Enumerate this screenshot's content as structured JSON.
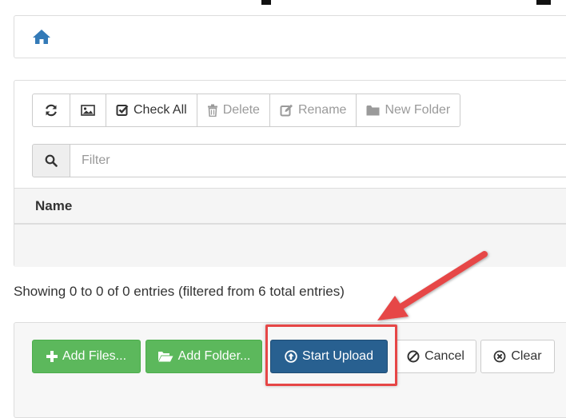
{
  "toolbar": {
    "refresh_icon": "refresh-icon",
    "image_icon": "image-icon",
    "check_all_label": "Check All",
    "delete_label": "Delete",
    "rename_label": "Rename",
    "new_folder_label": "New Folder"
  },
  "filter": {
    "placeholder": "Filter",
    "value": ""
  },
  "table": {
    "columns": [
      "Name"
    ],
    "rows": []
  },
  "status": {
    "showing_text": "Showing 0 to 0 of 0 entries (filtered from 6 total entries)"
  },
  "upload_bar": {
    "add_files_label": "Add Files...",
    "add_folder_label": "Add Folder...",
    "start_upload_label": "Start Upload",
    "cancel_label": "Cancel",
    "clear_label": "Clear"
  },
  "colors": {
    "home_icon": "#337ab7",
    "success": "#5cb85c",
    "primary": "#286090",
    "annotation": "#e64646"
  }
}
